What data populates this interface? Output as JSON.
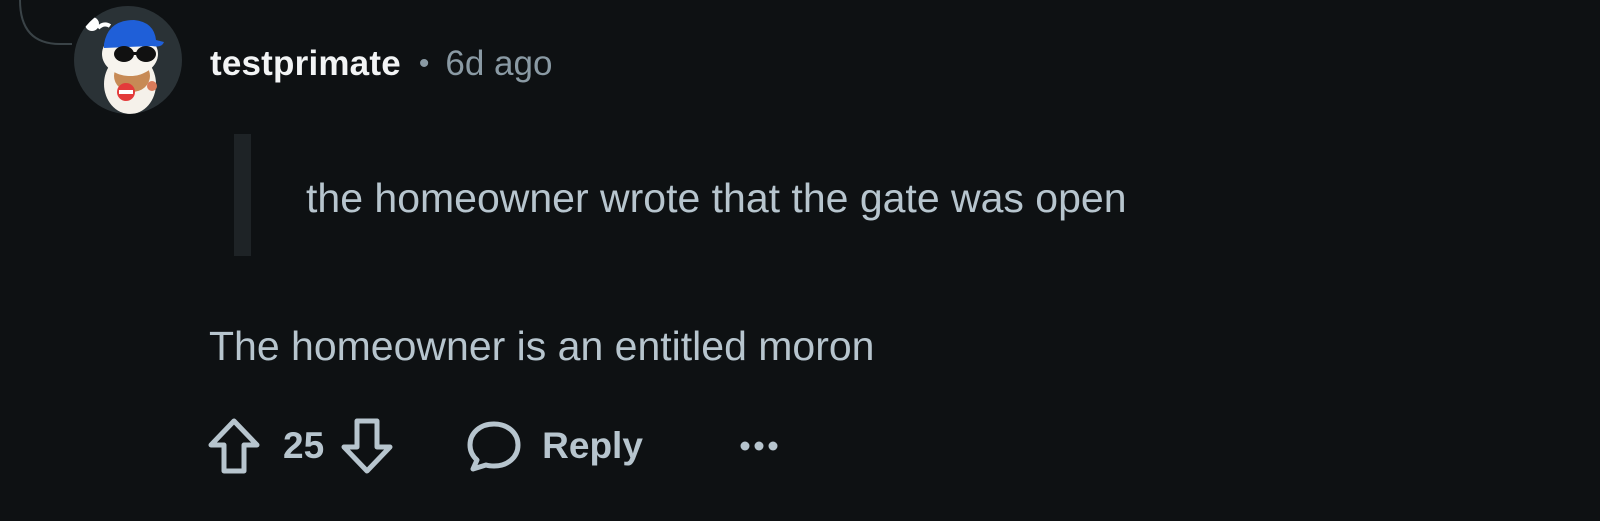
{
  "comment": {
    "author": "testprimate",
    "separator": "•",
    "time_ago": "6d ago",
    "quote": "the homeowner wrote that the gate was open",
    "body": "The homeowner is an entitled moron",
    "score": "25",
    "reply_label": "Reply"
  },
  "icons": {
    "avatar": "snoo-avatar-blue-cap-sunglasses",
    "upvote": "arrow-up-outline-icon",
    "downvote": "arrow-down-outline-icon",
    "reply": "speech-bubble-icon",
    "more": "ellipsis-icon"
  },
  "colors": {
    "background": "#0e1113",
    "username": "#f2f4f5",
    "meta": "#8a9aa4",
    "text": "#b7c5ce",
    "quote_bar": "#1e2326",
    "avatar_cap": "#1f5fd8"
  }
}
